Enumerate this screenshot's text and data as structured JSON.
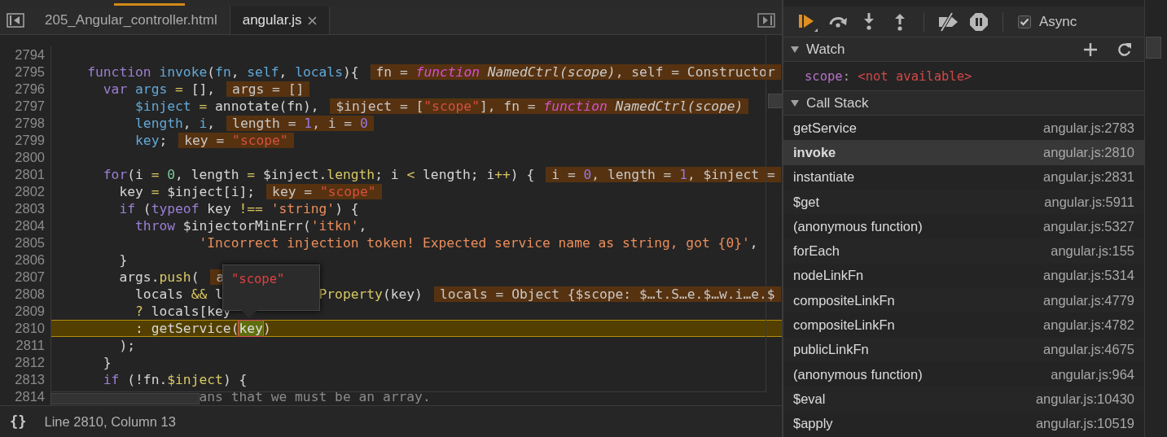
{
  "tabs": [
    {
      "label": "205_Angular_controller.html",
      "selected": false,
      "closable": false
    },
    {
      "label": "angular.js",
      "selected": true,
      "closable": true
    }
  ],
  "code": {
    "lines": [
      {
        "number": "2794",
        "current": false
      },
      {
        "number": "2795",
        "current": false,
        "tokens": [
          {
            "kind": "keyword",
            "text": "    function"
          },
          {
            "kind": "variable",
            "text": " invoke"
          },
          {
            "kind": "plain",
            "text": "("
          },
          {
            "kind": "variable",
            "text": "fn"
          },
          {
            "kind": "plain",
            "text": ", "
          },
          {
            "kind": "variable",
            "text": "self"
          },
          {
            "kind": "plain",
            "text": ", "
          },
          {
            "kind": "variable",
            "text": "locals"
          },
          {
            "kind": "plain",
            "text": "){"
          }
        ],
        "annotation": [
          {
            "kind": "plain",
            "text": "fn = "
          },
          {
            "kind": "fn-keyword",
            "text": "function"
          },
          {
            "kind": "fn-signature",
            "text": " NamedCtrl(scope)"
          },
          {
            "kind": "plain",
            "text": ", self = Constructor"
          }
        ]
      },
      {
        "number": "2796",
        "current": false,
        "tokens": [
          {
            "kind": "keyword",
            "text": "      var"
          },
          {
            "kind": "variable",
            "text": " args"
          },
          {
            "kind": "operator",
            "text": " ="
          },
          {
            "kind": "plain",
            "text": " [],"
          }
        ],
        "annotation": [
          {
            "kind": "plain",
            "text": "args = []"
          }
        ]
      },
      {
        "number": "2797",
        "current": false,
        "tokens": [
          {
            "kind": "variable",
            "text": "          $inject"
          },
          {
            "kind": "operator",
            "text": " ="
          },
          {
            "kind": "plain",
            "text": " annotate(fn),"
          }
        ],
        "annotation": [
          {
            "kind": "plain",
            "text": "$inject = ["
          },
          {
            "kind": "string",
            "text": "\"scope\""
          },
          {
            "kind": "plain",
            "text": "], fn = "
          },
          {
            "kind": "fn-keyword",
            "text": "function"
          },
          {
            "kind": "fn-signature",
            "text": " NamedCtrl(scope)"
          }
        ]
      },
      {
        "number": "2798",
        "current": false,
        "tokens": [
          {
            "kind": "variable",
            "text": "          length"
          },
          {
            "kind": "plain",
            "text": ", "
          },
          {
            "kind": "variable",
            "text": "i"
          },
          {
            "kind": "plain",
            "text": ","
          }
        ],
        "annotation": [
          {
            "kind": "plain",
            "text": "length = "
          },
          {
            "kind": "number",
            "text": "1"
          },
          {
            "kind": "plain",
            "text": ", i = "
          },
          {
            "kind": "number",
            "text": "0"
          }
        ]
      },
      {
        "number": "2799",
        "current": false,
        "tokens": [
          {
            "kind": "variable",
            "text": "          key"
          },
          {
            "kind": "plain",
            "text": ";"
          }
        ],
        "annotation": [
          {
            "kind": "plain",
            "text": "key = "
          },
          {
            "kind": "string",
            "text": "\"scope\""
          }
        ]
      },
      {
        "number": "2800",
        "current": false
      },
      {
        "number": "2801",
        "current": false,
        "tokens": [
          {
            "kind": "keyword",
            "text": "      for"
          },
          {
            "kind": "plain",
            "text": "(i "
          },
          {
            "kind": "operator",
            "text": "="
          },
          {
            "kind": "number",
            "text": " 0"
          },
          {
            "kind": "plain",
            "text": ", length "
          },
          {
            "kind": "operator",
            "text": "="
          },
          {
            "kind": "plain",
            "text": " $inject."
          },
          {
            "kind": "property",
            "text": "length"
          },
          {
            "kind": "plain",
            "text": "; i "
          },
          {
            "kind": "operator",
            "text": "<"
          },
          {
            "kind": "plain",
            "text": " length; i"
          },
          {
            "kind": "operator",
            "text": "++"
          },
          {
            "kind": "plain",
            "text": ") {"
          }
        ],
        "annotation": [
          {
            "kind": "plain",
            "text": "i = "
          },
          {
            "kind": "number",
            "text": "0"
          },
          {
            "kind": "plain",
            "text": ", length = "
          },
          {
            "kind": "number",
            "text": "1"
          },
          {
            "kind": "plain",
            "text": ", $inject ="
          }
        ]
      },
      {
        "number": "2802",
        "current": false,
        "tokens": [
          {
            "kind": "plain",
            "text": "        key "
          },
          {
            "kind": "operator",
            "text": "="
          },
          {
            "kind": "plain",
            "text": " $inject[i];"
          }
        ],
        "annotation": [
          {
            "kind": "plain",
            "text": "key = "
          },
          {
            "kind": "string",
            "text": "\"scope\""
          }
        ]
      },
      {
        "number": "2803",
        "current": false,
        "tokens": [
          {
            "kind": "keyword",
            "text": "        if"
          },
          {
            "kind": "plain",
            "text": " ("
          },
          {
            "kind": "keyword",
            "text": "typeof"
          },
          {
            "kind": "plain",
            "text": " key "
          },
          {
            "kind": "operator",
            "text": "!=="
          },
          {
            "kind": "string",
            "text": " 'string'"
          },
          {
            "kind": "plain",
            "text": ") {"
          }
        ]
      },
      {
        "number": "2804",
        "current": false,
        "tokens": [
          {
            "kind": "keyword",
            "text": "          throw"
          },
          {
            "kind": "plain",
            "text": " $injectorMinErr("
          },
          {
            "kind": "string",
            "text": "'itkn'"
          },
          {
            "kind": "plain",
            "text": ","
          }
        ]
      },
      {
        "number": "2805",
        "current": false,
        "tokens": [
          {
            "kind": "string",
            "text": "                  'Incorrect injection token! Expected service name as string, got {0}'"
          },
          {
            "kind": "plain",
            "text": ","
          }
        ]
      },
      {
        "number": "2806",
        "current": false,
        "tokens": [
          {
            "kind": "plain",
            "text": "        }"
          }
        ]
      },
      {
        "number": "2807",
        "current": false,
        "tokens": [
          {
            "kind": "plain",
            "text": "        args."
          },
          {
            "kind": "property",
            "text": "push"
          },
          {
            "kind": "plain",
            "text": "("
          }
        ],
        "annotation": [
          {
            "kind": "plain",
            "text": "a"
          }
        ]
      },
      {
        "number": "2808",
        "current": false,
        "tokens": [
          {
            "kind": "plain",
            "text": "          locals "
          },
          {
            "kind": "operator",
            "text": "&&"
          },
          {
            "kind": "plain",
            "text": " l"
          },
          {
            "kind": "property",
            "text": "            Property"
          },
          {
            "kind": "plain",
            "text": "(key)"
          }
        ],
        "annotation": [
          {
            "kind": "plain",
            "text": "locals = Object {$scope: $…t.S…e.$…w.i…e.$"
          }
        ]
      },
      {
        "number": "2809",
        "current": false,
        "tokens": [
          {
            "kind": "operator",
            "text": "          ?"
          },
          {
            "kind": "plain",
            "text": " locals[key"
          }
        ]
      },
      {
        "number": "2810",
        "current": true,
        "tokens": [
          {
            "kind": "plain",
            "text": "          : getService("
          },
          {
            "kind": "hovered",
            "text": "key"
          },
          {
            "kind": "plain",
            "text": ")"
          }
        ]
      },
      {
        "number": "2811",
        "current": false,
        "tokens": [
          {
            "kind": "plain",
            "text": "        );"
          }
        ]
      },
      {
        "number": "2812",
        "current": false,
        "tokens": [
          {
            "kind": "plain",
            "text": "      }"
          }
        ]
      },
      {
        "number": "2813",
        "current": false,
        "tokens": [
          {
            "kind": "keyword",
            "text": "      if"
          },
          {
            "kind": "plain",
            "text": " (!fn."
          },
          {
            "kind": "property",
            "text": "$inject"
          },
          {
            "kind": "plain",
            "text": ") {"
          }
        ]
      },
      {
        "number": "2814",
        "current": false,
        "tokens": [
          {
            "kind": "comment",
            "text": "                  ans that we must be an array."
          }
        ]
      }
    ],
    "tooltip": {
      "text": "\"scope\""
    }
  },
  "status_bar": {
    "format_label": "{}",
    "position": "Line 2810, Column 13"
  },
  "debugger": {
    "async": {
      "label": "Async",
      "checked": true
    },
    "watch": {
      "title": "Watch",
      "expanded": true,
      "items": [
        {
          "name": "scope",
          "separator": ":",
          "value": "<not available>"
        }
      ]
    },
    "call_stack": {
      "title": "Call Stack",
      "expanded": true,
      "frames": [
        {
          "name": "getService",
          "location": "angular.js:2783",
          "selected": false
        },
        {
          "name": "invoke",
          "location": "angular.js:2810",
          "selected": true
        },
        {
          "name": "instantiate",
          "location": "angular.js:2831",
          "selected": false
        },
        {
          "name": "$get",
          "location": "angular.js:5911",
          "selected": false
        },
        {
          "name": "(anonymous function)",
          "location": "angular.js:5327",
          "selected": false
        },
        {
          "name": "forEach",
          "location": "angular.js:155",
          "selected": false
        },
        {
          "name": "nodeLinkFn",
          "location": "angular.js:5314",
          "selected": false
        },
        {
          "name": "compositeLinkFn",
          "location": "angular.js:4779",
          "selected": false
        },
        {
          "name": "compositeLinkFn",
          "location": "angular.js:4782",
          "selected": false
        },
        {
          "name": "publicLinkFn",
          "location": "angular.js:4675",
          "selected": false
        },
        {
          "name": "(anonymous function)",
          "location": "angular.js:964",
          "selected": false
        },
        {
          "name": "$eval",
          "location": "angular.js:10430",
          "selected": false
        },
        {
          "name": "$apply",
          "location": "angular.js:10519",
          "selected": false
        }
      ]
    }
  }
}
